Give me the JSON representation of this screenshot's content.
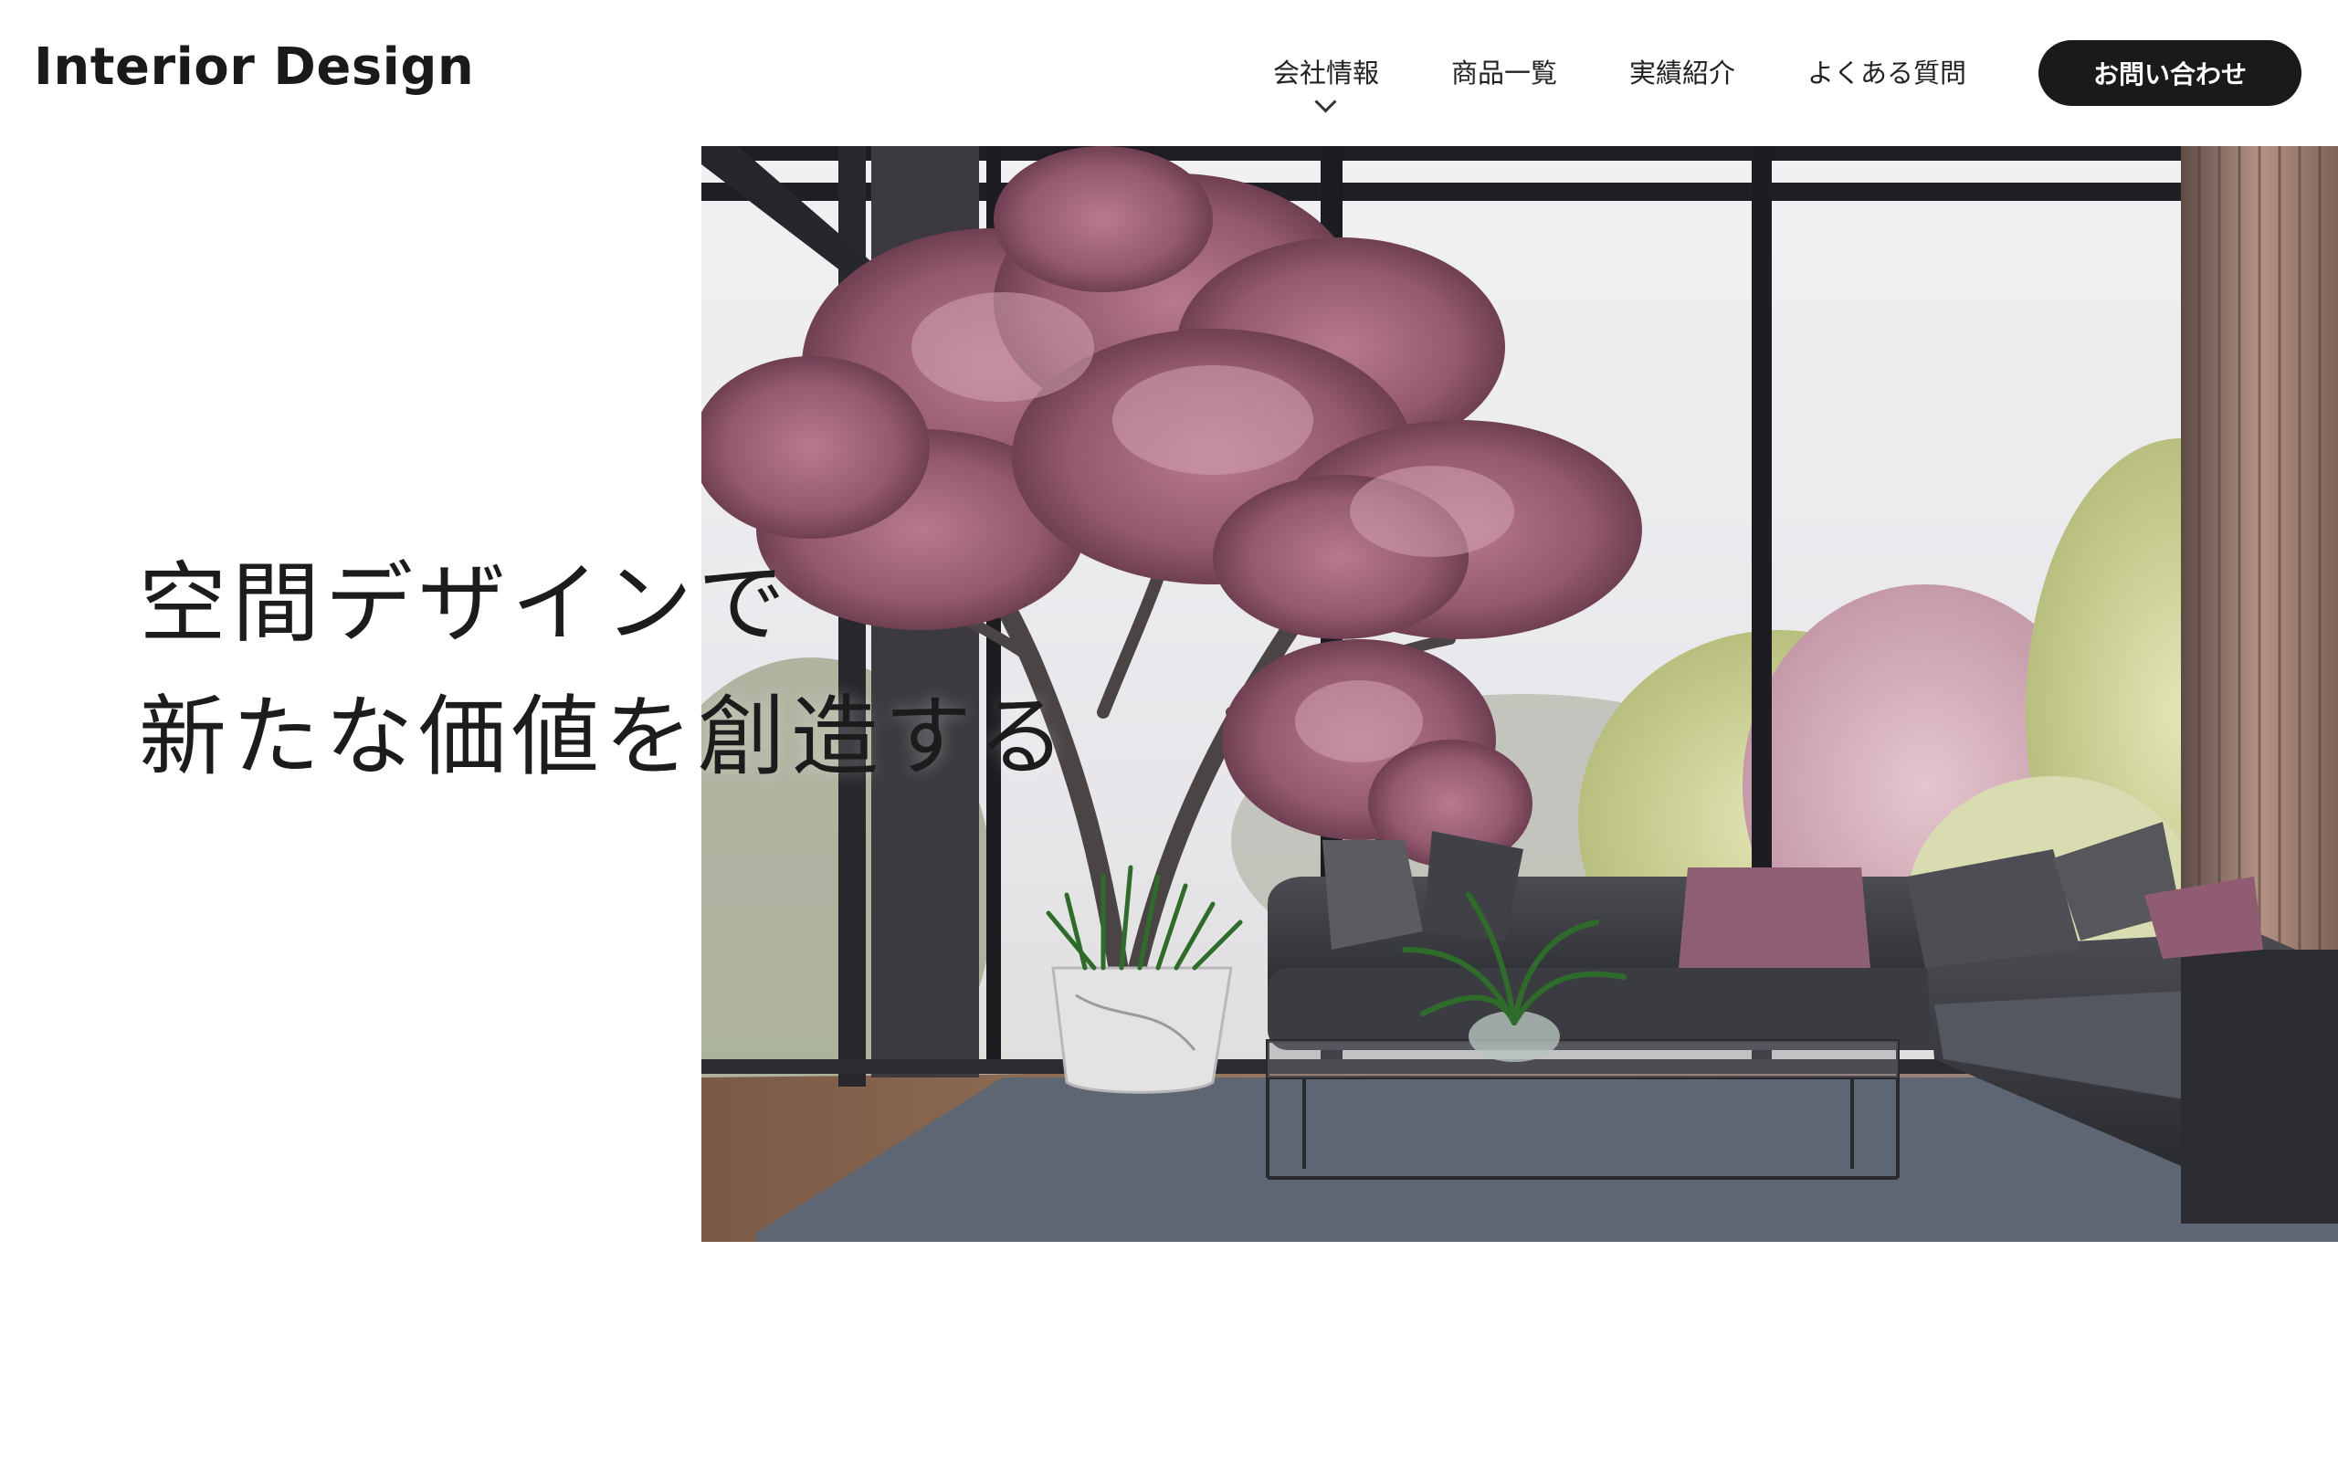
{
  "header": {
    "logo": "Interior Design",
    "nav": [
      {
        "label": "会社情報",
        "has_submenu": true
      },
      {
        "label": "商品一覧",
        "has_submenu": false
      },
      {
        "label": "実績紹介",
        "has_submenu": false
      },
      {
        "label": "よくある質問",
        "has_submenu": false
      }
    ],
    "contact_label": "お問い合わせ"
  },
  "hero": {
    "line1": "空間デザインで",
    "line2": "新たな価値を創造する"
  },
  "colors": {
    "text": "#1a1a1a",
    "button_bg": "#1a1a1a",
    "button_text": "#ffffff",
    "blossom": "#a5687e",
    "background": "#ffffff"
  }
}
